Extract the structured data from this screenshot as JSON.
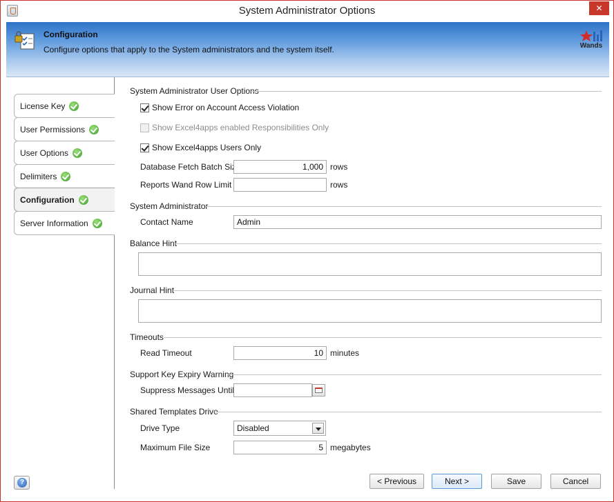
{
  "window": {
    "title": "System Administrator Options",
    "close_glyph": "✕"
  },
  "banner": {
    "title": "Configuration",
    "description": "Configure options that apply to the System administrators and the system itself.",
    "logo_text": "Wands"
  },
  "nav": {
    "items": [
      {
        "label": "License Key"
      },
      {
        "label": "User Permissions"
      },
      {
        "label": "User Options"
      },
      {
        "label": "Delimiters"
      },
      {
        "label": "Configuration",
        "active": true
      },
      {
        "label": "Server Information"
      }
    ],
    "help_glyph": "?"
  },
  "sections": {
    "user_options": "System Administrator User Options",
    "system_admin": "System Administrator",
    "balance_hint": "Balance Hint",
    "journal_hint": "Journal Hint",
    "timeouts": "Timeouts",
    "support_key": "Support Key Expiry Warning",
    "shared_templates": "Shared Templates Drive"
  },
  "options": {
    "show_error": {
      "label": "Show Error on Account Access Violation",
      "checked": true
    },
    "show_responsibilities": {
      "label": "Show Excel4apps enabled Responsibilities Only",
      "checked": false,
      "disabled": true
    },
    "show_users": {
      "label": "Show Excel4apps Users Only",
      "checked": true
    }
  },
  "fields": {
    "fetch_batch_label": "Database Fetch Batch Size",
    "fetch_batch_value": "1,000",
    "fetch_batch_unit": "rows",
    "row_limit_label": "Reports Wand Row Limit",
    "row_limit_value": "",
    "row_limit_unit": "rows",
    "contact_label": "Contact Name",
    "contact_value": "Admin",
    "balance_hint_value": "",
    "journal_hint_value": "",
    "read_timeout_label": "Read Timeout",
    "read_timeout_value": "10",
    "read_timeout_unit": "minutes",
    "suppress_label": "Suppress Messages Until",
    "suppress_value": "",
    "drive_type_label": "Drive Type",
    "drive_type_value": "Disabled",
    "max_file_label": "Maximum File Size",
    "max_file_value": "5",
    "max_file_unit": "megabytes"
  },
  "buttons": {
    "previous": "< Previous",
    "next": "Next >",
    "save": "Save",
    "cancel": "Cancel"
  },
  "colors": {
    "accent": "#c7372a",
    "banner": "#5a97dc",
    "check_green": "#3e9b2b"
  }
}
